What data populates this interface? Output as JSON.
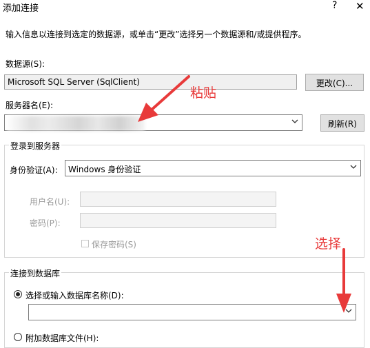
{
  "window": {
    "title": "添加连接",
    "help_label": "?",
    "close_label": "✕"
  },
  "description": "输入信息以连接到选定的数据源，或单击“更改”选择另一个数据源和/或提供程序。",
  "datasource": {
    "label": "数据源(S):",
    "value": "Microsoft SQL Server (SqlClient)",
    "change_button": "更改(C)..."
  },
  "server": {
    "label": "服务器名(E):",
    "refresh_button": "刷新(R)"
  },
  "login_group": {
    "legend": "登录到服务器",
    "auth_label": "身份验证(A):",
    "auth_value": "Windows 身份验证",
    "username_label": "用户名(U):",
    "password_label": "密码(P):",
    "save_password_label": "保存密码(S)"
  },
  "db_group": {
    "legend": "连接到数据库",
    "select_db_radio": "选择或输入数据库名称(D):",
    "attach_db_radio": "附加数据库文件(H):"
  },
  "annotations": {
    "paste": "粘贴",
    "select": "选择",
    "color": "#e83a3a"
  }
}
